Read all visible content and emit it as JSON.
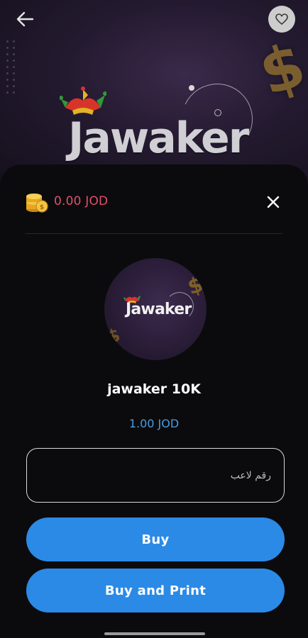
{
  "hero": {
    "brand_title": "Jawaker",
    "decor_symbol": "$"
  },
  "header": {
    "back_icon": "arrow-left-icon",
    "favorite_icon": "heart-icon"
  },
  "wallet": {
    "coin_icon": "coin-stack-icon",
    "balance": "0.00 JOD",
    "balance_color": "#e0506b"
  },
  "sheet": {
    "close_icon": "close-icon"
  },
  "product": {
    "image_title": "Jawaker",
    "name": "jawaker 10K",
    "price": "1.00 JOD",
    "price_color": "#4a9be0"
  },
  "form": {
    "player_id_placeholder": "رقم لاعب",
    "player_id_value": ""
  },
  "actions": {
    "buy_label": "Buy",
    "buy_print_label": "Buy and Print",
    "accent_color": "#2b8ae6"
  }
}
